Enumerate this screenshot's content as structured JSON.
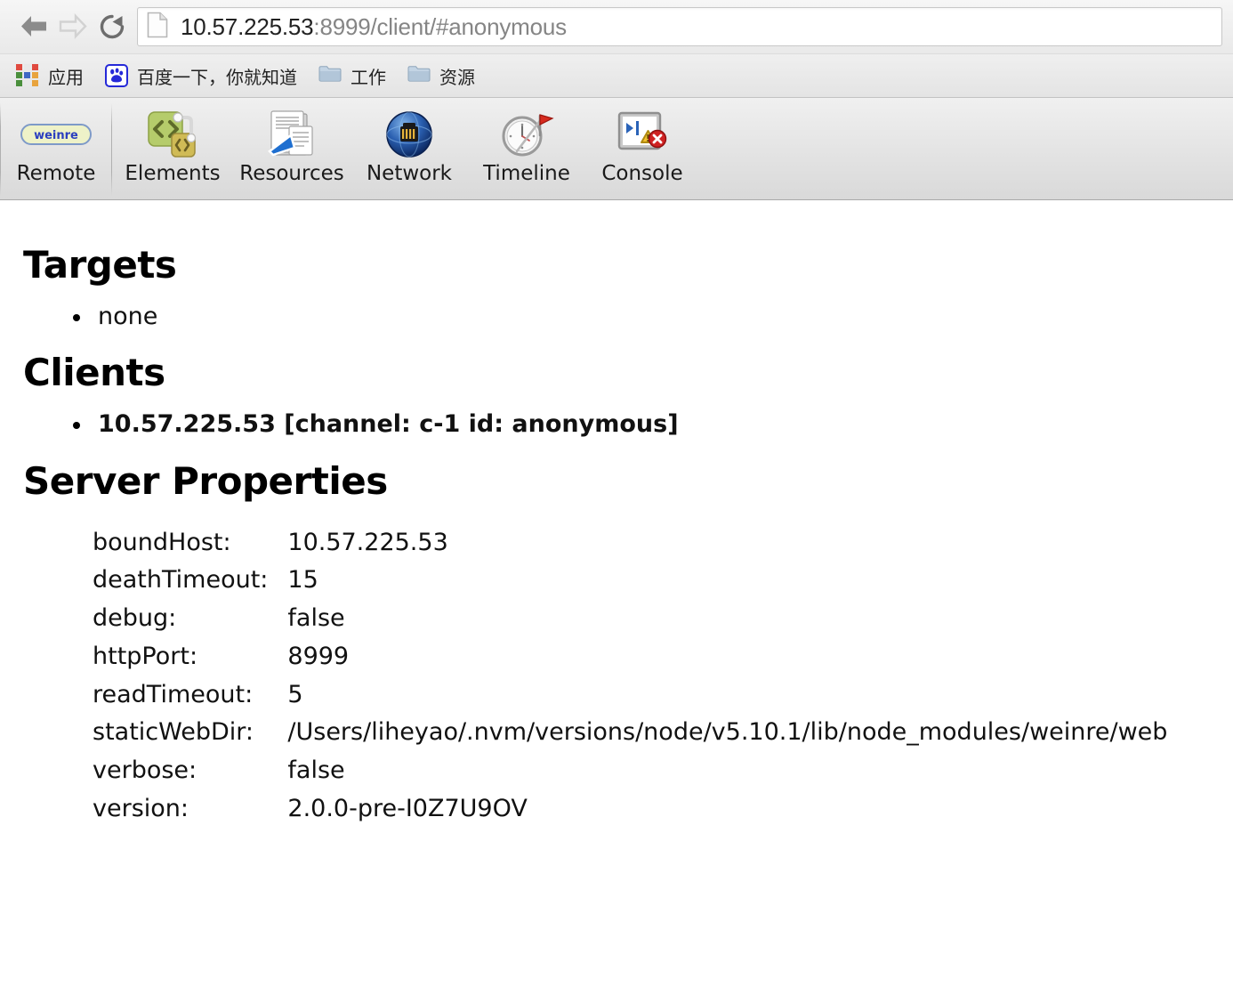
{
  "browser": {
    "nav": {
      "back_icon": "back-arrow-icon",
      "forward_icon": "forward-arrow-icon",
      "reload_icon": "reload-icon"
    },
    "url": {
      "page_icon": "page-document-icon",
      "host": "10.57.225.53",
      "rest": ":8999/client/#anonymous",
      "full": "10.57.225.53:8999/client/#anonymous"
    },
    "bookmarks": [
      {
        "label": "应用",
        "icon": "apps-grid-icon"
      },
      {
        "label": "百度一下，你就知道",
        "icon": "baidu-paw-icon"
      },
      {
        "label": "工作",
        "icon": "folder-icon"
      },
      {
        "label": "资源",
        "icon": "folder-icon"
      }
    ]
  },
  "weinre_toolbar": {
    "tabs": [
      {
        "label": "Remote",
        "icon": "weinre-logo-icon"
      },
      {
        "label": "Elements",
        "icon": "elements-code-icon"
      },
      {
        "label": "Resources",
        "icon": "resources-documents-icon"
      },
      {
        "label": "Network",
        "icon": "network-globe-icon"
      },
      {
        "label": "Timeline",
        "icon": "timeline-clock-flag-icon"
      },
      {
        "label": "Console",
        "icon": "console-warning-icon"
      }
    ],
    "logo_text": "weinre"
  },
  "main": {
    "targets": {
      "title": "Targets",
      "items": [
        "none"
      ]
    },
    "clients": {
      "title": "Clients",
      "items": [
        "10.57.225.53 [channel: c-1 id: anonymous]"
      ]
    },
    "server_properties": {
      "title": "Server Properties",
      "rows": [
        {
          "key": "boundHost:",
          "value": "10.57.225.53"
        },
        {
          "key": "deathTimeout:",
          "value": "15"
        },
        {
          "key": "debug:",
          "value": "false"
        },
        {
          "key": "httpPort:",
          "value": "8999"
        },
        {
          "key": "readTimeout:",
          "value": "5"
        },
        {
          "key": "staticWebDir:",
          "value": "/Users/liheyao/.nvm/versions/node/v5.10.1/lib/node_modules/weinre/web"
        },
        {
          "key": "verbose:",
          "value": "false"
        },
        {
          "key": "version:",
          "value": "2.0.0-pre-I0Z7U9OV"
        }
      ]
    }
  },
  "colors": {
    "url_host": "#222222",
    "url_rest": "#858585",
    "chrome_bg": "#e9e9e9",
    "toolbar_bg": "#d9d9d9",
    "page_bg": "#ffffff",
    "text": "#111111",
    "baidu_blue": "#2529d8",
    "elements_green": "#b5cc6b",
    "network_blue": "#2a5fb0",
    "timeline_red": "#d62b1f",
    "warning_yellow": "#f2c230",
    "folder_blue": "#b9cde0"
  }
}
